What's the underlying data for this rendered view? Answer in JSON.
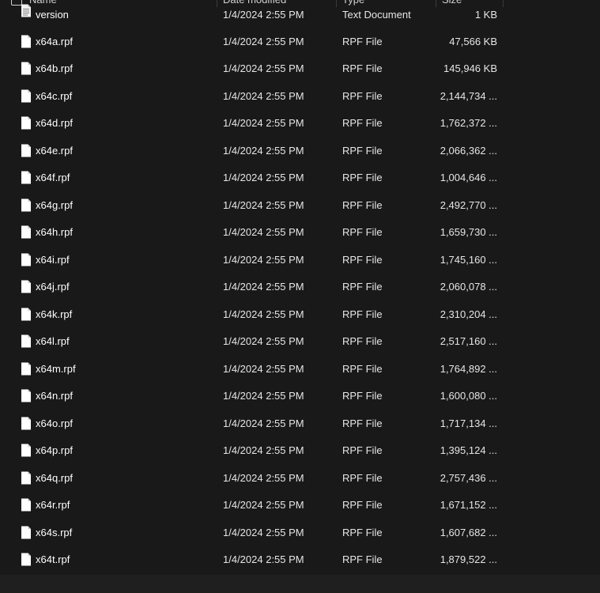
{
  "header": {
    "name": "Name",
    "date_modified": "Date modified",
    "type": "Type",
    "size": "Size"
  },
  "files": [
    {
      "name": "version",
      "date": "1/4/2024 2:55 PM",
      "type": "Text Document",
      "size": "1 KB",
      "icon": "text-document-icon"
    },
    {
      "name": "x64a.rpf",
      "date": "1/4/2024 2:55 PM",
      "type": "RPF File",
      "size": "47,566 KB",
      "icon": "file-icon"
    },
    {
      "name": "x64b.rpf",
      "date": "1/4/2024 2:55 PM",
      "type": "RPF File",
      "size": "145,946 KB",
      "icon": "file-icon"
    },
    {
      "name": "x64c.rpf",
      "date": "1/4/2024 2:55 PM",
      "type": "RPF File",
      "size": "2,144,734 ...",
      "icon": "file-icon"
    },
    {
      "name": "x64d.rpf",
      "date": "1/4/2024 2:55 PM",
      "type": "RPF File",
      "size": "1,762,372 ...",
      "icon": "file-icon"
    },
    {
      "name": "x64e.rpf",
      "date": "1/4/2024 2:55 PM",
      "type": "RPF File",
      "size": "2,066,362 ...",
      "icon": "file-icon"
    },
    {
      "name": "x64f.rpf",
      "date": "1/4/2024 2:55 PM",
      "type": "RPF File",
      "size": "1,004,646 ...",
      "icon": "file-icon"
    },
    {
      "name": "x64g.rpf",
      "date": "1/4/2024 2:55 PM",
      "type": "RPF File",
      "size": "2,492,770 ...",
      "icon": "file-icon"
    },
    {
      "name": "x64h.rpf",
      "date": "1/4/2024 2:55 PM",
      "type": "RPF File",
      "size": "1,659,730 ...",
      "icon": "file-icon"
    },
    {
      "name": "x64i.rpf",
      "date": "1/4/2024 2:55 PM",
      "type": "RPF File",
      "size": "1,745,160 ...",
      "icon": "file-icon"
    },
    {
      "name": "x64j.rpf",
      "date": "1/4/2024 2:55 PM",
      "type": "RPF File",
      "size": "2,060,078 ...",
      "icon": "file-icon"
    },
    {
      "name": "x64k.rpf",
      "date": "1/4/2024 2:55 PM",
      "type": "RPF File",
      "size": "2,310,204 ...",
      "icon": "file-icon"
    },
    {
      "name": "x64l.rpf",
      "date": "1/4/2024 2:55 PM",
      "type": "RPF File",
      "size": "2,517,160 ...",
      "icon": "file-icon"
    },
    {
      "name": "x64m.rpf",
      "date": "1/4/2024 2:55 PM",
      "type": "RPF File",
      "size": "1,764,892 ...",
      "icon": "file-icon"
    },
    {
      "name": "x64n.rpf",
      "date": "1/4/2024 2:55 PM",
      "type": "RPF File",
      "size": "1,600,080 ...",
      "icon": "file-icon"
    },
    {
      "name": "x64o.rpf",
      "date": "1/4/2024 2:55 PM",
      "type": "RPF File",
      "size": "1,717,134 ...",
      "icon": "file-icon"
    },
    {
      "name": "x64p.rpf",
      "date": "1/4/2024 2:55 PM",
      "type": "RPF File",
      "size": "1,395,124 ...",
      "icon": "file-icon"
    },
    {
      "name": "x64q.rpf",
      "date": "1/4/2024 2:55 PM",
      "type": "RPF File",
      "size": "2,757,436 ...",
      "icon": "file-icon"
    },
    {
      "name": "x64r.rpf",
      "date": "1/4/2024 2:55 PM",
      "type": "RPF File",
      "size": "1,671,152 ...",
      "icon": "file-icon"
    },
    {
      "name": "x64s.rpf",
      "date": "1/4/2024 2:55 PM",
      "type": "RPF File",
      "size": "1,607,682 ...",
      "icon": "file-icon"
    },
    {
      "name": "x64t.rpf",
      "date": "1/4/2024 2:55 PM",
      "type": "RPF File",
      "size": "1,879,522 ...",
      "icon": "file-icon"
    }
  ],
  "colors": {
    "background": "#191919",
    "text": "#ffffff",
    "icon_fill": "#ffffff"
  }
}
